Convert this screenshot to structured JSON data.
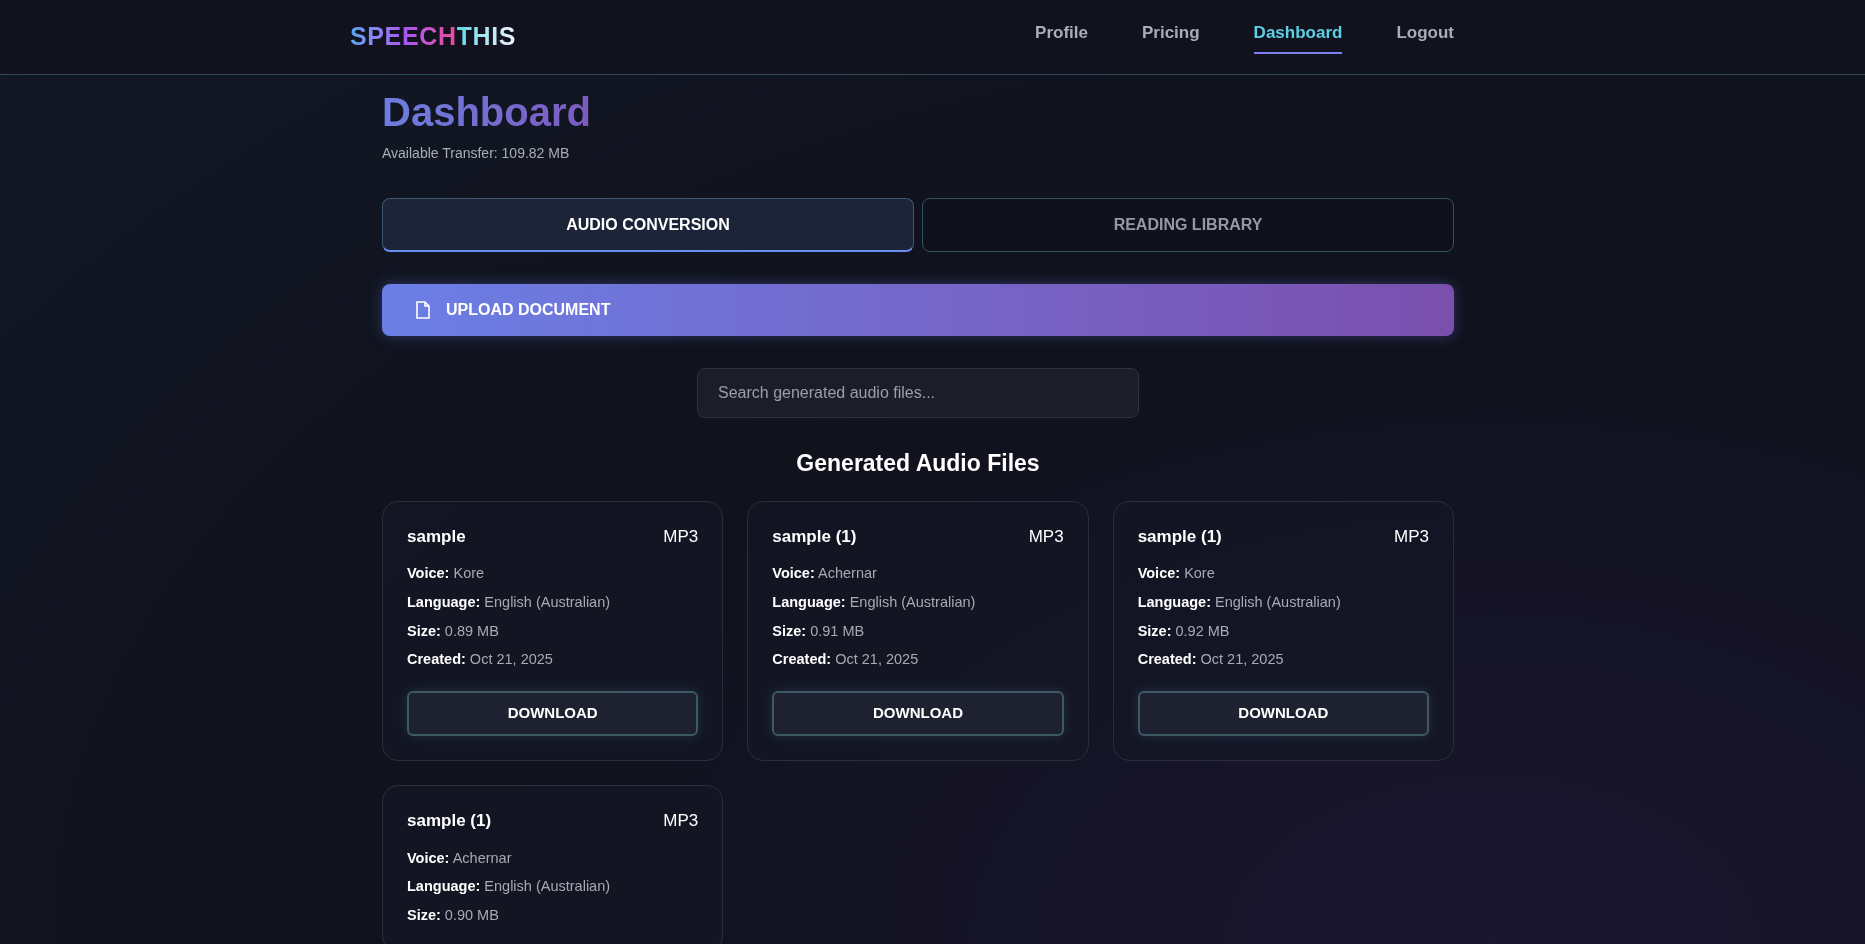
{
  "header": {
    "logo": [
      "SPEECH",
      "THIS"
    ],
    "nav": [
      {
        "label": "Profile",
        "selected": false
      },
      {
        "label": "Pricing",
        "selected": false
      },
      {
        "label": "Dashboard",
        "selected": true
      },
      {
        "label": "Logout",
        "selected": false
      }
    ]
  },
  "page": {
    "title": "Dashboard",
    "transfer": "Available Transfer: 109.82 MB"
  },
  "tabs": [
    {
      "label": "AUDIO CONVERSION",
      "selected": true
    },
    {
      "label": "READING LIBRARY",
      "selected": false
    }
  ],
  "upload_button": "UPLOAD DOCUMENT",
  "search": {
    "placeholder": "Search generated audio files..."
  },
  "section_title": "Generated Audio Files",
  "files": [
    {
      "name": "sample",
      "format": "MP3",
      "fields": [
        "**Voice:** Kore",
        "**Language:** English (Australian)",
        "**Size:** 0.89 MB",
        "**Created:** Oct 21, 2025"
      ],
      "button": "DOWNLOAD"
    },
    {
      "name": "sample (1)",
      "format": "MP3",
      "fields": [
        "**Voice:** Achernar",
        "**Language:** English (Australian)",
        "**Size:** 0.91 MB",
        "**Created:** Oct 21, 2025"
      ],
      "button": "DOWNLOAD"
    },
    {
      "name": "sample (1)",
      "format": "MP3",
      "fields": [
        "**Voice:** Kore",
        "**Language:** English (Australian)",
        "**Size:** 0.92 MB",
        "**Created:** Oct 21, 2025"
      ],
      "button": "DOWNLOAD"
    },
    {
      "name": "sample (1)",
      "format": "MP3",
      "fields": [
        "**Voice:** Achernar",
        "**Language:** English (Australian)",
        "**Size:** 0.90 MB"
      ]
    }
  ]
}
